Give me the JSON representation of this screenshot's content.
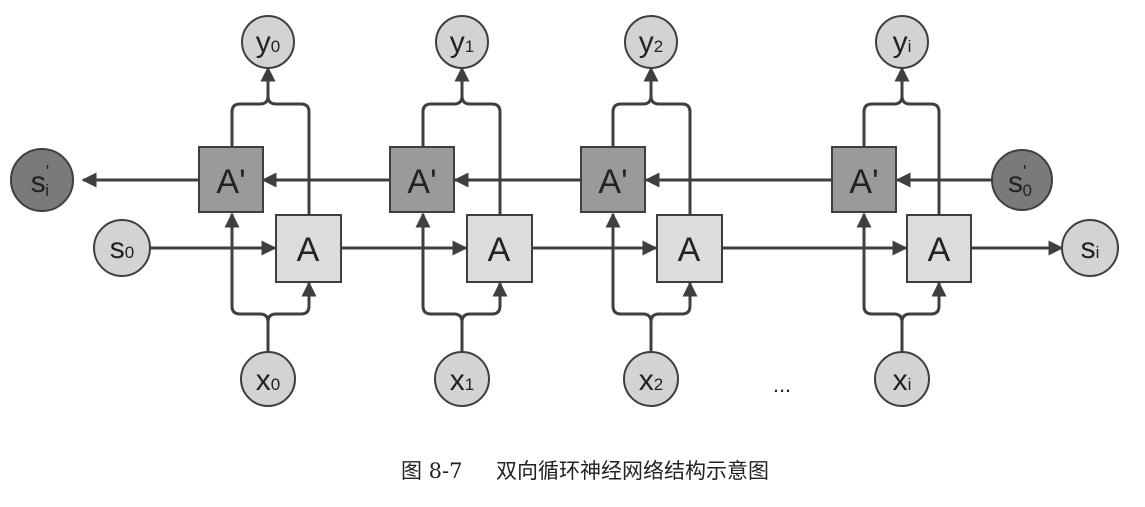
{
  "nodes": {
    "y0": {
      "main": "y",
      "sub": "0",
      "sup": ""
    },
    "y1": {
      "main": "y",
      "sub": "1",
      "sup": ""
    },
    "y2": {
      "main": "y",
      "sub": "2",
      "sup": ""
    },
    "yi": {
      "main": "y",
      "sub": "i",
      "sup": ""
    },
    "x0": {
      "main": "x",
      "sub": "0",
      "sup": ""
    },
    "x1": {
      "main": "x",
      "sub": "1",
      "sup": ""
    },
    "x2": {
      "main": "x",
      "sub": "2",
      "sup": ""
    },
    "xi": {
      "main": "x",
      "sub": "i",
      "sup": ""
    },
    "s0": {
      "main": "s",
      "sub": "0",
      "sup": ""
    },
    "si": {
      "main": "s",
      "sub": "i",
      "sup": ""
    },
    "s_prime_i": {
      "main": "s",
      "sub": "i",
      "sup": "'"
    },
    "s_prime_0": {
      "main": "s",
      "sub": "0",
      "sup": "'"
    }
  },
  "boxes": {
    "forward_label": "A",
    "backward_label": "A'"
  },
  "ellipsis": "...",
  "caption": {
    "figure_number": "图 8-7",
    "title": "双向循环神经网络结构示意图"
  },
  "colors": {
    "light_fill": "#d3d3d3",
    "dark_fill": "#7a7a7a",
    "backward_box_fill": "#9a9a9a",
    "forward_box_fill": "#dcdcdc",
    "stroke": "#3f3f3f"
  }
}
